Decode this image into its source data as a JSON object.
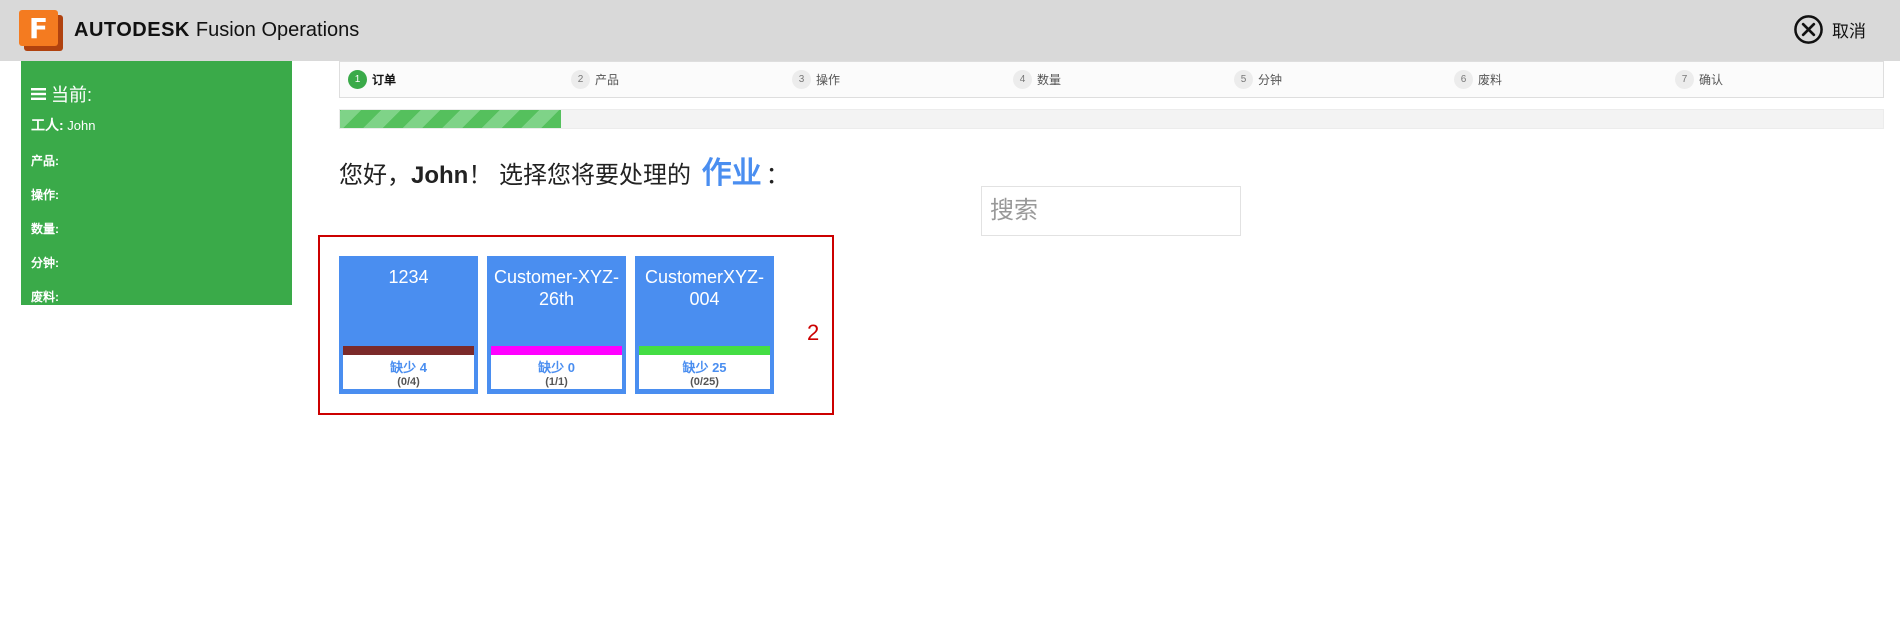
{
  "app": {
    "brand_name": "AUTODESK",
    "product_name": "Fusion Operations",
    "logo_letter": "F",
    "cancel_label": "取消"
  },
  "side": {
    "title": "当前:",
    "worker_label": "工人:",
    "worker_name": "John",
    "fields": [
      "产品:",
      "操作:",
      "数量:",
      "分钟:",
      "废料:"
    ]
  },
  "steps": [
    {
      "num": "1",
      "label": "订单"
    },
    {
      "num": "2",
      "label": "产品"
    },
    {
      "num": "3",
      "label": "操作"
    },
    {
      "num": "4",
      "label": "数量"
    },
    {
      "num": "5",
      "label": "分钟"
    },
    {
      "num": "6",
      "label": "废料"
    },
    {
      "num": "7",
      "label": "确认"
    }
  ],
  "active_step": "1",
  "progress": {
    "fraction": 0.143
  },
  "greeting": {
    "hello": "您好，",
    "name": "John",
    "mid": "！ 选择您将要处理的",
    "job": "作业",
    "end": "："
  },
  "search": {
    "placeholder": "搜索"
  },
  "highlight_label": "2",
  "cards": [
    {
      "title": "1234",
      "missing": "缺少 4",
      "ratio": "(0/4)",
      "bar_color": "#7b2a2a"
    },
    {
      "title": "Customer-XYZ-26th",
      "missing": "缺少 0",
      "ratio": "(1/1)",
      "bar_color": "#ff00ff"
    },
    {
      "title": "CustomerXYZ-004",
      "missing": "缺少 25",
      "ratio": "(0/25)",
      "bar_color": "#44dd44"
    }
  ],
  "colors": {
    "accent_green": "#3aaa49",
    "accent_blue": "#4a8ef0",
    "highlight_red": "#cc0000"
  }
}
